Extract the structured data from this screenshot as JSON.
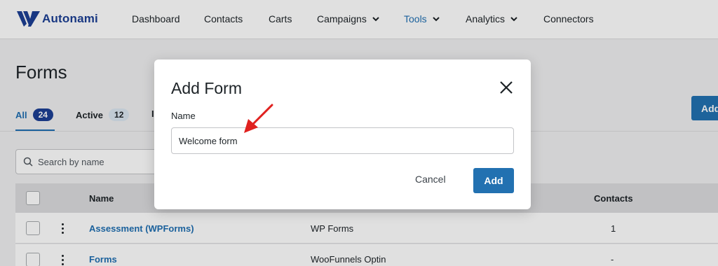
{
  "brand": {
    "name": "Autonami"
  },
  "nav": {
    "items": [
      {
        "label": "Dashboard"
      },
      {
        "label": "Contacts"
      },
      {
        "label": "Carts"
      },
      {
        "label": "Campaigns",
        "dropdown": true
      },
      {
        "label": "Tools",
        "dropdown": true,
        "active": true
      },
      {
        "label": "Analytics",
        "dropdown": true
      },
      {
        "label": "Connectors"
      }
    ]
  },
  "page": {
    "title": "Forms",
    "tabs": [
      {
        "label": "All",
        "count": "24",
        "active": true
      },
      {
        "label": "Active",
        "count": "12"
      },
      {
        "label": "I"
      }
    ],
    "add_button_label": "Add",
    "search_placeholder": "Search by name"
  },
  "table": {
    "columns": {
      "name": "Name",
      "contacts": "Contacts"
    },
    "rows": [
      {
        "name": "Assessment (WPForms)",
        "source": "WP Forms",
        "contacts": "1"
      },
      {
        "name": "Forms",
        "source": "WooFunnels Optin",
        "contacts": "-"
      }
    ]
  },
  "modal": {
    "title": "Add Form",
    "field_label": "Name",
    "field_value": "Welcome form",
    "cancel_label": "Cancel",
    "add_label": "Add"
  },
  "colors": {
    "primary": "#2271b1",
    "brand": "#1c3f94",
    "link": "#1f6fb2",
    "annotation_arrow": "#e0211f"
  }
}
